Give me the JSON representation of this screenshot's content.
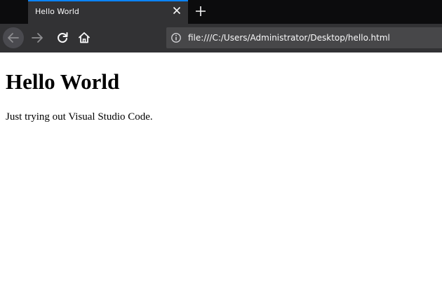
{
  "tab": {
    "title": "Hello World",
    "accent_color": "#0a84ff"
  },
  "icons": {
    "tab_close": "close-icon",
    "new_tab": "plus-icon",
    "back": "arrow-left-icon",
    "forward": "arrow-right-icon",
    "reload": "reload-icon",
    "home": "home-icon",
    "site_info": "info-icon"
  },
  "urlbar": {
    "url": "file:///C:/Users/Administrator/Desktop/hello.html"
  },
  "page": {
    "heading": "Hello World",
    "paragraph": "Just trying out Visual Studio Code."
  }
}
